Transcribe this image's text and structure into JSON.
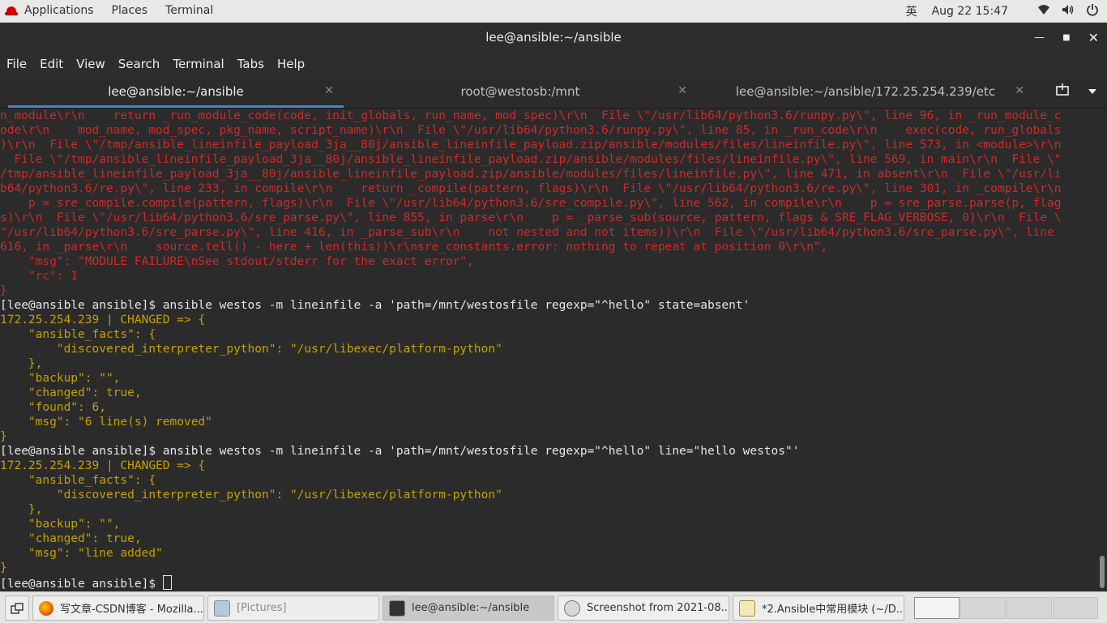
{
  "topbar": {
    "applications": "Applications",
    "places": "Places",
    "terminal": "Terminal",
    "input_method": "英",
    "clock": "Aug 22  15:47",
    "icons": [
      "wifi-icon",
      "volume-icon",
      "power-icon"
    ]
  },
  "window": {
    "title": "lee@ansible:~/ansible"
  },
  "menubar": {
    "items": [
      "File",
      "Edit",
      "View",
      "Search",
      "Terminal",
      "Tabs",
      "Help"
    ]
  },
  "tabs": [
    {
      "label": "lee@ansible:~/ansible",
      "active": true
    },
    {
      "label": "root@westosb:/mnt",
      "active": false
    },
    {
      "label": "lee@ansible:~/ansible/172.25.254.239/etc",
      "active": false
    }
  ],
  "terminal": {
    "lines": [
      {
        "color": "red",
        "text": "n_module\\r\\n    return _run_module_code(code, init_globals, run_name, mod_spec)\\r\\n  File \\\"/usr/lib64/python3.6/runpy.py\\\", line 96, in _run_module_c"
      },
      {
        "color": "red",
        "text": "ode\\r\\n    mod_name, mod_spec, pkg_name, script_name)\\r\\n  File \\\"/usr/lib64/python3.6/runpy.py\\\", line 85, in _run_code\\r\\n    exec(code, run_globals"
      },
      {
        "color": "red",
        "text": ")\\r\\n  File \\\"/tmp/ansible_lineinfile_payload_3ja__80j/ansible_lineinfile_payload.zip/ansible/modules/files/lineinfile.py\\\", line 573, in <module>\\r\\n"
      },
      {
        "color": "red",
        "text": "  File \\\"/tmp/ansible_lineinfile_payload_3ja__80j/ansible_lineinfile_payload.zip/ansible/modules/files/lineinfile.py\\\", line 569, in main\\r\\n  File \\\""
      },
      {
        "color": "red",
        "text": "/tmp/ansible_lineinfile_payload_3ja__80j/ansible_lineinfile_payload.zip/ansible/modules/files/lineinfile.py\\\", line 471, in absent\\r\\n  File \\\"/usr/li"
      },
      {
        "color": "red",
        "text": "b64/python3.6/re.py\\\", line 233, in compile\\r\\n    return _compile(pattern, flags)\\r\\n  File \\\"/usr/lib64/python3.6/re.py\\\", line 301, in _compile\\r\\n"
      },
      {
        "color": "red",
        "text": "    p = sre_compile.compile(pattern, flags)\\r\\n  File \\\"/usr/lib64/python3.6/sre_compile.py\\\", line 562, in compile\\r\\n    p = sre_parse.parse(p, flag"
      },
      {
        "color": "red",
        "text": "s)\\r\\n  File \\\"/usr/lib64/python3.6/sre_parse.py\\\", line 855, in parse\\r\\n    p = _parse_sub(source, pattern, flags & SRE_FLAG_VERBOSE, 0)\\r\\n  File \\"
      },
      {
        "color": "red",
        "text": "\"/usr/lib64/python3.6/sre_parse.py\\\", line 416, in _parse_sub\\r\\n    not nested and not items))\\r\\n  File \\\"/usr/lib64/python3.6/sre_parse.py\\\", line"
      },
      {
        "color": "red",
        "text": "616, in _parse\\r\\n    source.tell() - here + len(this))\\r\\nsre_constants.error: nothing to repeat at position 0\\r\\n\","
      },
      {
        "color": "red",
        "text": "    \"msg\": \"MODULE FAILURE\\nSee stdout/stderr for the exact error\","
      },
      {
        "color": "red",
        "text": "    \"rc\": 1"
      },
      {
        "color": "red",
        "text": "}"
      },
      {
        "color": "wht",
        "text": "[lee@ansible ansible]$ ansible westos -m lineinfile -a 'path=/mnt/westosfile regexp=\"^hello\" state=absent'"
      },
      {
        "color": "yel",
        "text": "172.25.254.239 | CHANGED => {"
      },
      {
        "color": "yel",
        "text": "    \"ansible_facts\": {"
      },
      {
        "color": "yel",
        "text": "        \"discovered_interpreter_python\": \"/usr/libexec/platform-python\""
      },
      {
        "color": "yel",
        "text": "    },"
      },
      {
        "color": "yel",
        "text": "    \"backup\": \"\","
      },
      {
        "color": "yel",
        "text": "    \"changed\": true,"
      },
      {
        "color": "yel",
        "text": "    \"found\": 6,"
      },
      {
        "color": "yel",
        "text": "    \"msg\": \"6 line(s) removed\""
      },
      {
        "color": "yel",
        "text": "}"
      },
      {
        "color": "wht",
        "text": "[lee@ansible ansible]$ ansible westos -m lineinfile -a 'path=/mnt/westosfile regexp=\"^hello\" line=\"hello westos\"'"
      },
      {
        "color": "yel",
        "text": "172.25.254.239 | CHANGED => {"
      },
      {
        "color": "yel",
        "text": "    \"ansible_facts\": {"
      },
      {
        "color": "yel",
        "text": "        \"discovered_interpreter_python\": \"/usr/libexec/platform-python\""
      },
      {
        "color": "yel",
        "text": "    },"
      },
      {
        "color": "yel",
        "text": "    \"backup\": \"\","
      },
      {
        "color": "yel",
        "text": "    \"changed\": true,"
      },
      {
        "color": "yel",
        "text": "    \"msg\": \"line added\""
      },
      {
        "color": "yel",
        "text": "}"
      }
    ],
    "prompt": "[lee@ansible ansible]$ "
  },
  "taskbar": {
    "items": [
      {
        "label": "写文章-CSDN博客 - Mozilla...",
        "icon": "firefox-icon",
        "active": false
      },
      {
        "label": "[Pictures]",
        "icon": "file-manager-icon",
        "active": false
      },
      {
        "label": "lee@ansible:~/ansible",
        "icon": "terminal-icon",
        "active": true
      },
      {
        "label": "Screenshot from 2021-08...",
        "icon": "image-viewer-icon",
        "active": false
      },
      {
        "label": "*2.Ansible中常用模块 (~/D...",
        "icon": "text-editor-icon",
        "active": false
      }
    ],
    "workspaces": 4,
    "current_workspace": 1
  },
  "colors": {
    "terminal_bg": "#2b2b2b",
    "error_red": "#cc2b2b",
    "changed_yellow": "#c4a000",
    "tab_accent": "#3d86d6"
  }
}
